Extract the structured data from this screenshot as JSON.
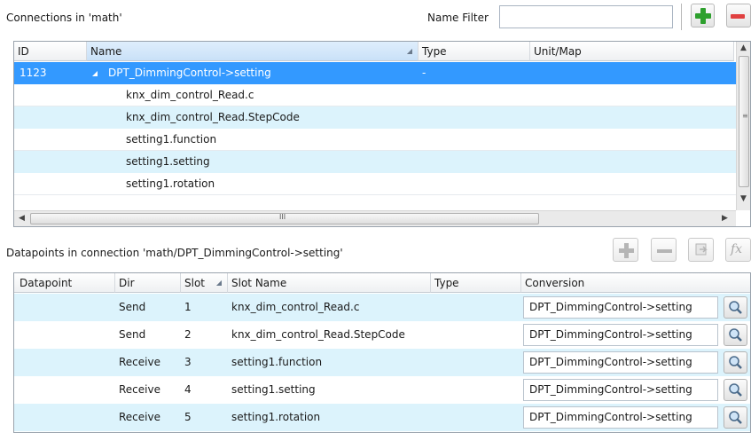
{
  "connections": {
    "title": "Connections in 'math'",
    "filter_label": "Name Filter",
    "filter_value": "",
    "columns": [
      "ID",
      "Name",
      "Type",
      "Unit/Map"
    ],
    "rows": [
      {
        "id": "1123",
        "name": "DPT_DimmingControl->setting",
        "type": "-",
        "unit": "",
        "selected": true,
        "expander": "◢"
      },
      {
        "id": "",
        "name": "knx_dim_control_Read.c",
        "type": "",
        "unit": ""
      },
      {
        "id": "",
        "name": "knx_dim_control_Read.StepCode",
        "type": "",
        "unit": ""
      },
      {
        "id": "",
        "name": "setting1.function",
        "type": "",
        "unit": ""
      },
      {
        "id": "",
        "name": "setting1.setting",
        "type": "",
        "unit": ""
      },
      {
        "id": "",
        "name": "setting1.rotation",
        "type": "",
        "unit": ""
      }
    ],
    "hscroll_grip": "III"
  },
  "datapoints": {
    "title": "Datapoints in connection 'math/DPT_DimmingControl->setting'",
    "columns": [
      "Datapoint",
      "Dir",
      "Slot",
      "Slot Name",
      "Type",
      "Conversion"
    ],
    "rows": [
      {
        "datapoint": "",
        "dir": "Send",
        "slot": "1",
        "slot_name": "knx_dim_control_Read.c",
        "type": "",
        "conversion": "DPT_DimmingControl->setting"
      },
      {
        "datapoint": "",
        "dir": "Send",
        "slot": "2",
        "slot_name": "knx_dim_control_Read.StepCode",
        "type": "",
        "conversion": "DPT_DimmingControl->setting"
      },
      {
        "datapoint": "",
        "dir": "Receive",
        "slot": "3",
        "slot_name": "setting1.function",
        "type": "",
        "conversion": "DPT_DimmingControl->setting"
      },
      {
        "datapoint": "",
        "dir": "Receive",
        "slot": "4",
        "slot_name": "setting1.setting",
        "type": "",
        "conversion": "DPT_DimmingControl->setting"
      },
      {
        "datapoint": "",
        "dir": "Receive",
        "slot": "5",
        "slot_name": "setting1.rotation",
        "type": "",
        "conversion": "DPT_DimmingControl->setting"
      }
    ],
    "toolbar": {
      "fx_label": "fx"
    }
  },
  "icons": [
    "plus-icon",
    "minus-icon",
    "search-icon",
    "formula-icon",
    "copy-icon"
  ],
  "colors": {
    "selection": "#3399ff",
    "alt_row": "#dcf3fc",
    "add_green": "#2ea02e",
    "remove_red": "#e04040"
  }
}
